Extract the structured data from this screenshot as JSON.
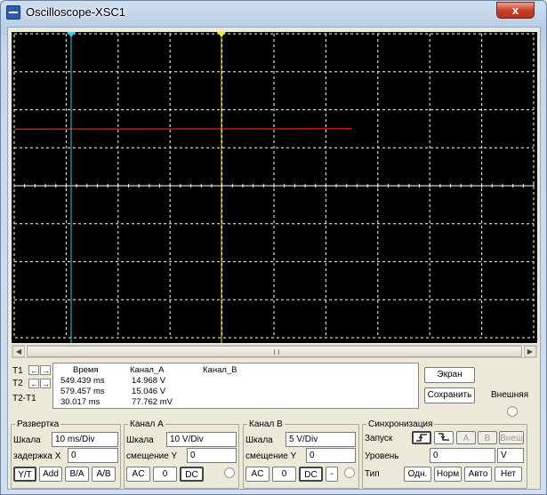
{
  "window": {
    "title": "Oscilloscope-XSC1",
    "close": "x"
  },
  "colors": {
    "channel_a": "#c0191a",
    "cursor_t1": "#3fc7e6",
    "cursor_t2": "#f1e53a",
    "grid": "#ffffff",
    "screen_bg": "#000000"
  },
  "cursors": {
    "t1_label": "T1",
    "t2_label": "T2",
    "t2t1_label": "T2-T1"
  },
  "readout": {
    "headers": {
      "time": "Время",
      "a": "Канал_A",
      "b": "Канал_B"
    },
    "rows": [
      {
        "time": "549.439 ms",
        "a": "14.968 V",
        "b": ""
      },
      {
        "time": "579.457 ms",
        "a": "15.046 V",
        "b": ""
      },
      {
        "time": "30.017 ms",
        "a": "77.762 mV",
        "b": ""
      }
    ]
  },
  "side": {
    "screen": "Экран",
    "save": "Сохранить",
    "external": "Внешняя"
  },
  "timebase": {
    "legend": "Развертка",
    "scale_label": "Шкала",
    "scale_value": "10 ms/Div",
    "xpos_label": "задержка X",
    "xpos_value": "0",
    "modes": [
      "Y/T",
      "Add",
      "B/A",
      "A/B"
    ]
  },
  "channel_a": {
    "legend": "Канал A",
    "scale_label": "Шкала",
    "scale_value": "10  V/Div",
    "ypos_label": "смещение Y",
    "ypos_value": "0",
    "coupling": [
      "AC",
      "0",
      "DC"
    ]
  },
  "channel_b": {
    "legend": "Канал B",
    "scale_label": "Шкала",
    "scale_value": "5  V/Div",
    "ypos_label": "смещение Y",
    "ypos_value": "0",
    "coupling": [
      "AC",
      "0",
      "DC",
      "-"
    ]
  },
  "trigger": {
    "legend": "Синхронизация",
    "edge_label": "Запуск",
    "level_label": "Уровень",
    "level_value": "0",
    "level_unit": "V",
    "type_label": "Тип",
    "source": [
      "A",
      "B",
      "Внеш"
    ],
    "modes": [
      "Одн.",
      "Норм",
      "Авто",
      "Нет"
    ]
  },
  "chart_data": {
    "type": "line",
    "grid": true,
    "divisions_x": 10,
    "divisions_y": 8,
    "series": [
      {
        "points": [
          [
            0,
            14.9
          ],
          [
            0.65,
            15.0
          ]
        ]
      }
    ]
  }
}
